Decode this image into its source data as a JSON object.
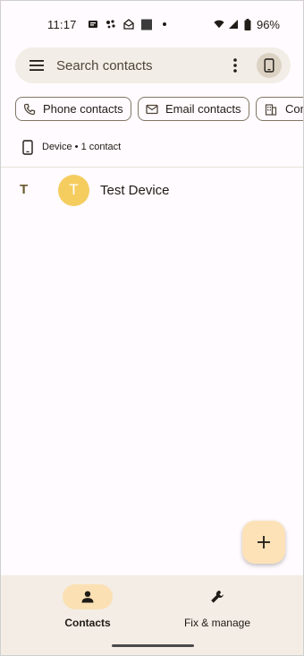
{
  "status_bar": {
    "time": "11:17",
    "battery": "96%",
    "notification_icons": [
      "news-icon",
      "slack-icon",
      "email-icon",
      "square-app-icon",
      "dot-icon"
    ]
  },
  "search": {
    "placeholder": "Search contacts"
  },
  "chips": [
    {
      "label": "Phone contacts",
      "icon": "phone-icon"
    },
    {
      "label": "Email contacts",
      "icon": "mail-icon"
    },
    {
      "label": "Com",
      "icon": "building-icon"
    }
  ],
  "account_header": {
    "label": "Device • 1 contact",
    "icon": "phone-device-icon"
  },
  "contacts": [
    {
      "section": "T",
      "initial": "T",
      "name": "Test Device",
      "avatar_color": "#f5cd5f"
    }
  ],
  "fab": {
    "icon": "plus-icon"
  },
  "bottom_nav": {
    "items": [
      {
        "label": "Contacts",
        "icon": "person-icon",
        "active": true
      },
      {
        "label": "Fix & manage",
        "icon": "wrench-icon",
        "active": false
      }
    ]
  },
  "colors": {
    "search_bg": "#f2ede6",
    "avatar": "#f5cd5f",
    "fab": "#fde2b8",
    "nav_active": "#fbe0b4",
    "nav_bg": "#f3ede5"
  }
}
